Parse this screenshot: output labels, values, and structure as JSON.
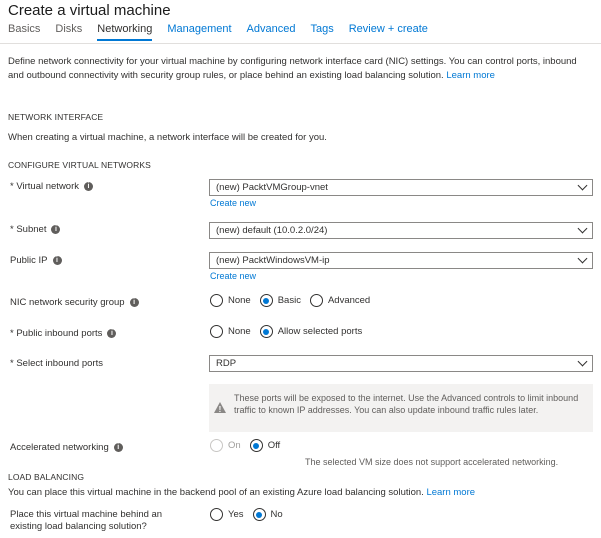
{
  "page": {
    "title": "Create a virtual machine"
  },
  "tabs": [
    {
      "label": "Basics"
    },
    {
      "label": "Disks"
    },
    {
      "label": "Networking"
    },
    {
      "label": "Management"
    },
    {
      "label": "Advanced"
    },
    {
      "label": "Tags"
    },
    {
      "label": "Review + create"
    }
  ],
  "description": {
    "text": "Define network connectivity for your virtual machine by configuring network interface card (NIC) settings. You can control ports, inbound and outbound connectivity with security group rules, or place behind an existing load balancing solution.",
    "link": "Learn more"
  },
  "network_interface": {
    "heading": "NETWORK INTERFACE",
    "text": "When creating a virtual machine, a network interface will be created for you."
  },
  "vnet_section": {
    "heading": "CONFIGURE VIRTUAL NETWORKS"
  },
  "fields": {
    "virtual_network": {
      "label": "Virtual network",
      "value": "(new) PacktVMGroup-vnet",
      "create_new": "Create new"
    },
    "subnet": {
      "label": "Subnet",
      "value": "(new) default (10.0.2.0/24)"
    },
    "public_ip": {
      "label": "Public IP",
      "value": "(new) PacktWindowsVM-ip",
      "create_new": "Create new"
    },
    "nic_nsg": {
      "label": "NIC network security group",
      "options": [
        "None",
        "Basic",
        "Advanced"
      ],
      "selected": "Basic"
    },
    "public_inbound_ports": {
      "label": "Public inbound ports",
      "options": [
        "None",
        "Allow selected ports"
      ],
      "selected": "Allow selected ports"
    },
    "select_inbound_ports": {
      "label": "Select inbound ports",
      "value": "RDP"
    },
    "warning": "These ports will be exposed to the internet. Use the Advanced controls to limit inbound traffic to known IP addresses. You can also update inbound traffic rules later.",
    "accelerated_networking": {
      "label": "Accelerated networking",
      "options": [
        "On",
        "Off"
      ],
      "selected": "Off",
      "note": "The selected VM size does not support accelerated networking."
    }
  },
  "load_balancing": {
    "heading": "LOAD BALANCING",
    "text": "You can place this virtual machine in the backend pool of an existing Azure load balancing solution.",
    "link": "Learn more",
    "question_line1": "Place this virtual machine behind an",
    "question_line2": "existing load balancing solution?",
    "options": [
      "Yes",
      "No"
    ],
    "selected": "No"
  },
  "colors": {
    "accent": "#0078d4",
    "text": "#323130",
    "muted": "#605e5c",
    "border": "#8a8886"
  }
}
